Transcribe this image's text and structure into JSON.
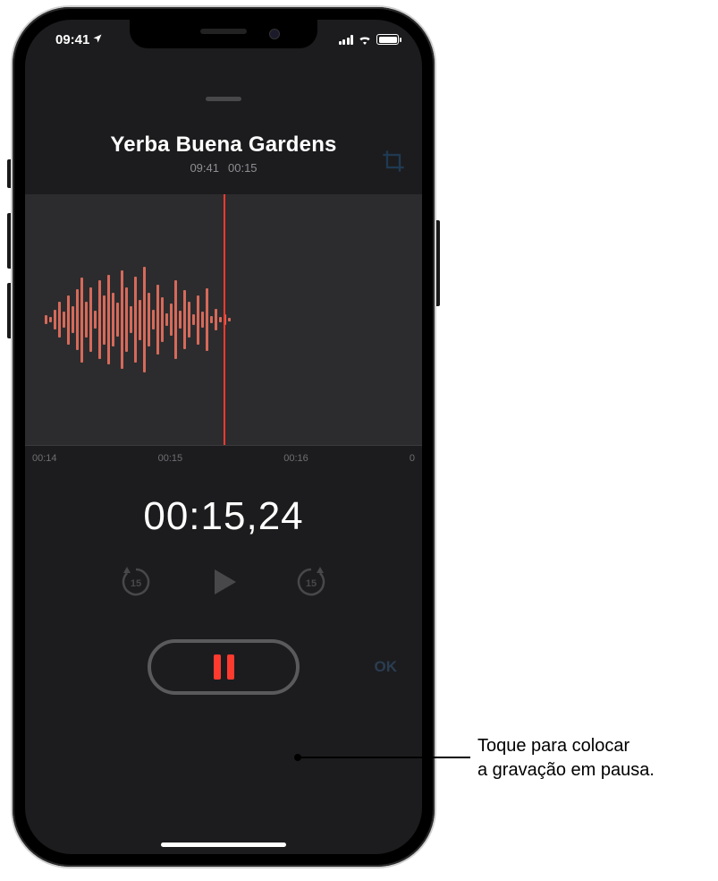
{
  "status": {
    "time": "09:41",
    "location_icon": "◤"
  },
  "recording": {
    "title": "Yerba Buena Gardens",
    "created_time": "09:41",
    "duration": "00:15"
  },
  "ruler": {
    "t0": "00:14",
    "t1": "00:15",
    "t2": "00:16",
    "t3": "0"
  },
  "timer": "00:15,24",
  "controls": {
    "skip_back_label": "15",
    "skip_fwd_label": "15",
    "ok_label": "OK"
  },
  "callout": {
    "line1": "Toque para colocar",
    "line2": "a gravação em pausa."
  },
  "waveform_heights": [
    10,
    6,
    22,
    40,
    18,
    55,
    30,
    68,
    95,
    40,
    72,
    20,
    88,
    55,
    100,
    60,
    38,
    110,
    72,
    30,
    96,
    45,
    118,
    60,
    22,
    78,
    50,
    14,
    36,
    88,
    20,
    66,
    40,
    12,
    55,
    18,
    70,
    8,
    24,
    6,
    12,
    4
  ]
}
